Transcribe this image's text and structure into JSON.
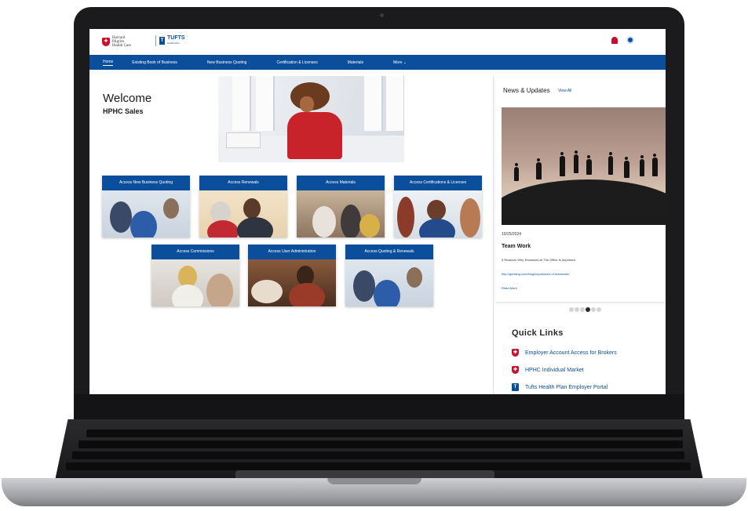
{
  "header": {
    "logo_harvard_text": "Harvard Pilgrim Health Care",
    "logo_tufts_text": "TUFTS",
    "logo_tufts_sub": "Health Plan"
  },
  "nav": {
    "items": [
      {
        "label": "Home"
      },
      {
        "label": "Existing Book of Business"
      },
      {
        "label": "New Business Quoting"
      },
      {
        "label": "Certification & Licenses"
      },
      {
        "label": "Materials"
      },
      {
        "label": "More ⌄"
      }
    ]
  },
  "main": {
    "welcome_title": "Welcome",
    "welcome_subtitle": "HPHC Sales",
    "tiles": [
      {
        "label": "Access New Business Quoting"
      },
      {
        "label": "Access Renewals"
      },
      {
        "label": "Access Materials"
      },
      {
        "label": "Access Certifications & Licenses"
      },
      {
        "label": "Access Commissions"
      },
      {
        "label": "Access User Administration"
      },
      {
        "label": "Access Quoting & Renewals"
      }
    ]
  },
  "news": {
    "title": "News & Updates",
    "view_all": "View All",
    "date": "10/25/2024",
    "headline": "Team Work",
    "description": "5 Reasons Why Teamwork At The Office Is Important",
    "link": "http://getcling.com/blog/importance-of-teamwork/",
    "read_more": "Read More",
    "carousel_count": 6,
    "carousel_active": 3
  },
  "quick_links": {
    "title": "Quick Links",
    "items": [
      {
        "label": "Employer Account Access for Brokers",
        "icon": "harvard-shield-icon"
      },
      {
        "label": "HPHC Individual Market",
        "icon": "harvard-shield-icon"
      },
      {
        "label": "Tufts Health Plan Employer Portal",
        "icon": "tufts-t-icon"
      }
    ]
  },
  "colors": {
    "brand_blue": "#0b4f9c",
    "brand_red": "#c8102e"
  }
}
